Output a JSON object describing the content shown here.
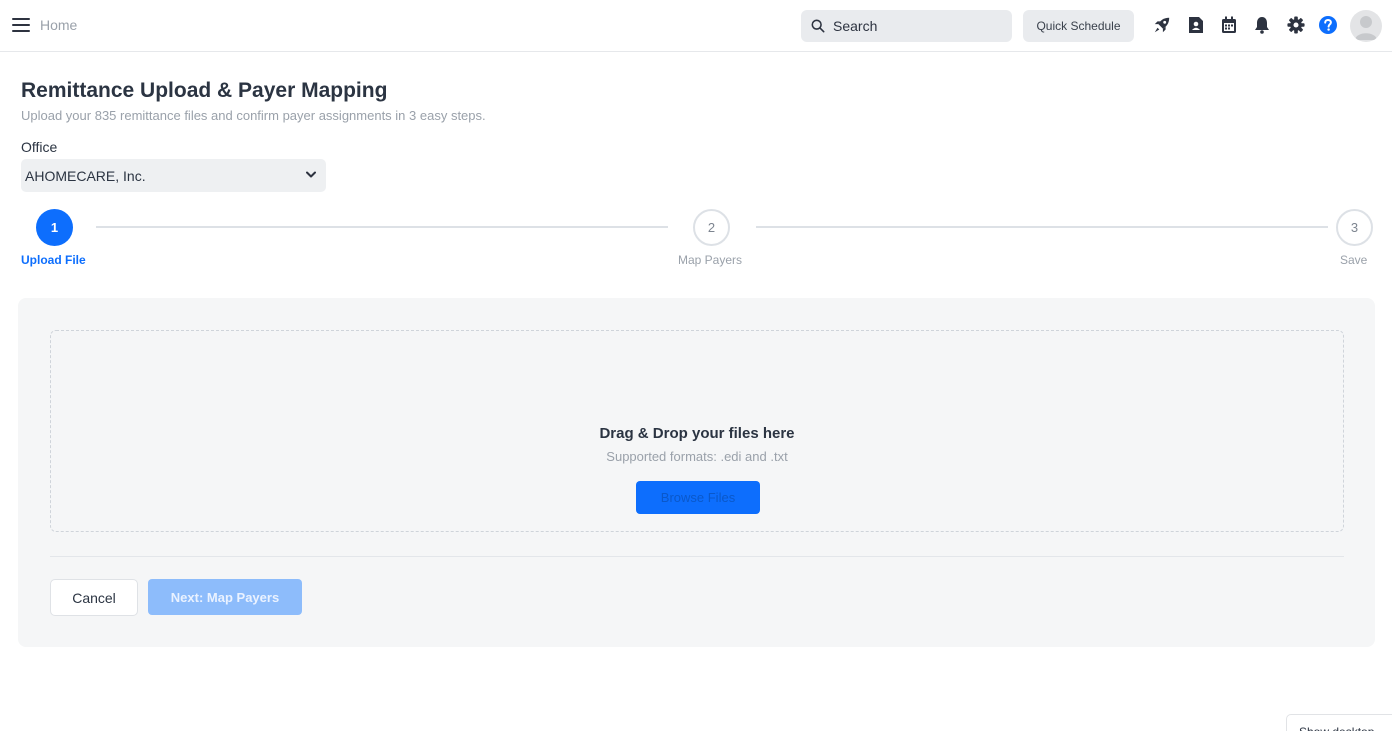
{
  "topbar": {
    "home_label": "Home",
    "search_placeholder": "Search",
    "quick_schedule_label": "Quick Schedule",
    "icons": [
      "rocket-icon",
      "contact-card-icon",
      "calendar-icon",
      "bell-icon",
      "gear-icon",
      "help-icon",
      "avatar"
    ]
  },
  "page": {
    "title": "Remittance Upload & Payer Mapping",
    "subtitle": "Upload your 835 remittance files and confirm payer assignments in 3 easy steps."
  },
  "office": {
    "label": "Office",
    "selected": "AHOMECARE, Inc."
  },
  "steps": [
    {
      "number": "1",
      "label": "Upload File",
      "state": "active"
    },
    {
      "number": "2",
      "label": "Map Payers",
      "state": "pending"
    },
    {
      "number": "3",
      "label": "Save",
      "state": "pending"
    }
  ],
  "dropzone": {
    "title": "Drag & Drop your files here",
    "subtitle": "Supported formats: .edi and .txt",
    "browse_label": "Browse Files"
  },
  "actions": {
    "cancel_label": "Cancel",
    "next_label": "Next: Map Payers"
  },
  "footer": {
    "show_desktop_label": "Show desktop"
  },
  "colors": {
    "accent": "#0d6efd",
    "accent_disabled": "#8dbcfb",
    "help_icon": "#0d6efd"
  }
}
